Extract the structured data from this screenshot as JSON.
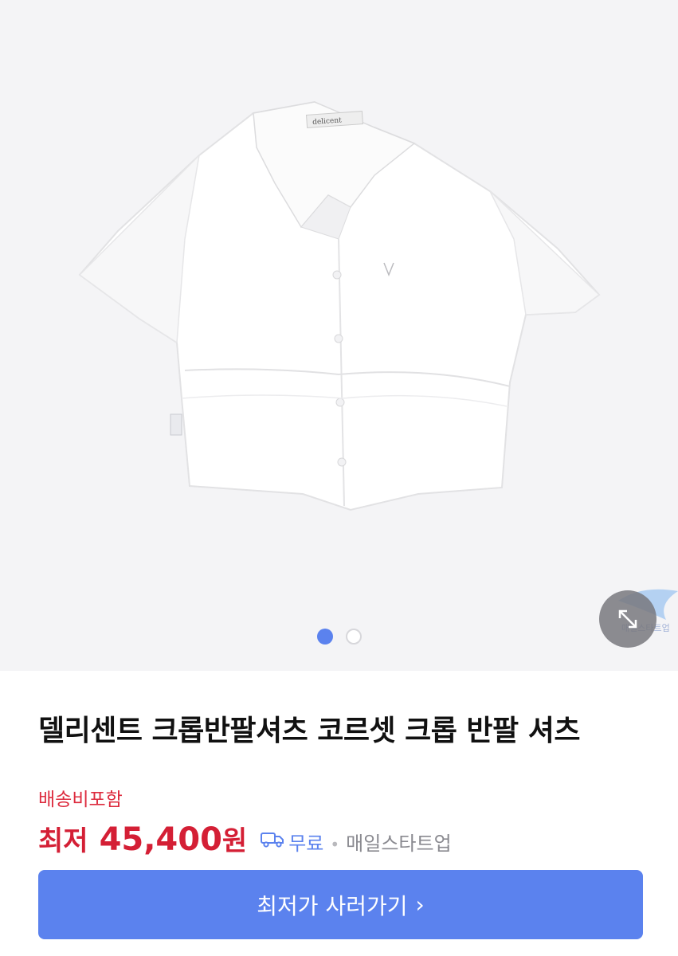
{
  "product": {
    "title": "델리센트 크롭반팔셔츠 코르셋 크롭 반팔 셔츠",
    "shipping_note": "배송비포함",
    "price_prefix": "최저",
    "price": "45,400",
    "price_unit": "원",
    "delivery_label": "무료",
    "separator": "•",
    "seller": "매일스타트업"
  },
  "gallery": {
    "current_page": 1,
    "total_pages": 2,
    "image_icon": "white-crop-shirt-image",
    "expand_icon": "expand-arrows-icon"
  },
  "cta": {
    "label": "최저가 사러가기",
    "arrow": "›"
  },
  "colors": {
    "accent": "#5b82ee",
    "price_red": "#d41f35",
    "gallery_bg": "#f4f4f6"
  }
}
